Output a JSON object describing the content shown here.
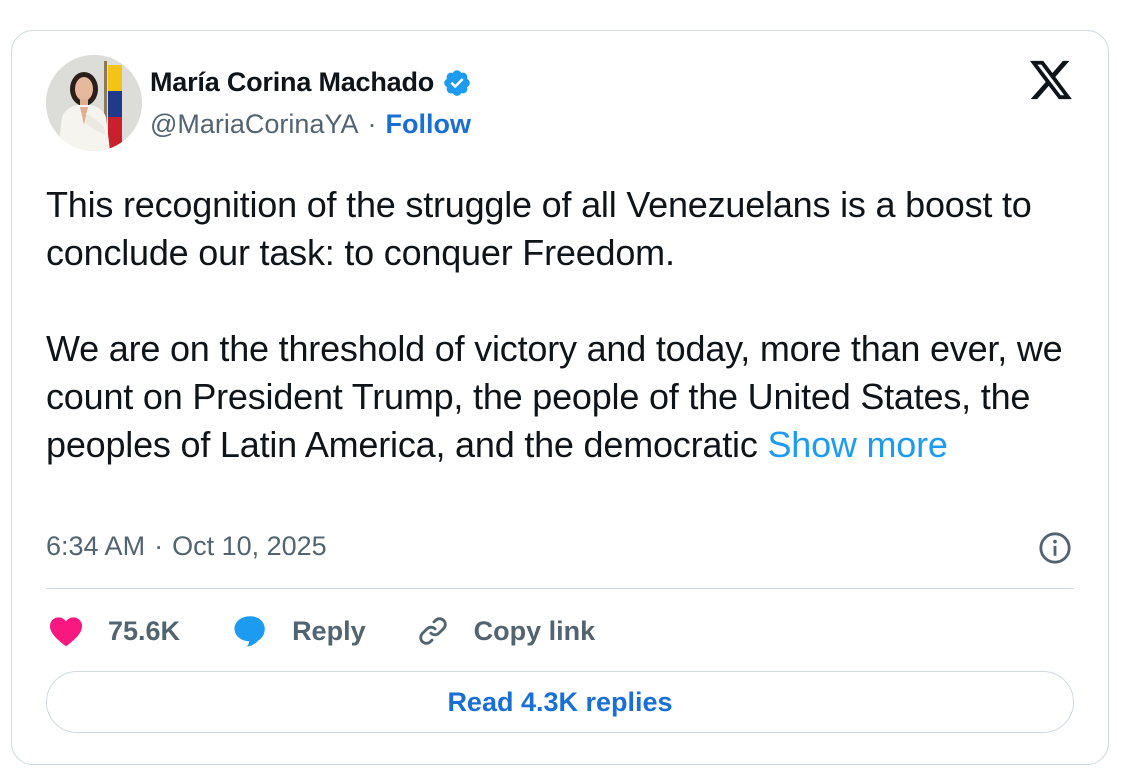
{
  "author": {
    "name": "María Corina Machado",
    "handle": "@MariaCorinaYA",
    "separator": "·",
    "follow_label": "Follow",
    "verified_icon": "verified-badge-icon",
    "avatar_icon": "profile-photo"
  },
  "brand_icon": "x-logo-icon",
  "tweet": {
    "paragraph1": "This recognition of the struggle of all Venezuelans is a boost to conclude our task: to conquer Freedom.",
    "paragraph2": "We are on the threshold of victory and today, more than ever, we count on President Trump, the people of the United States, the peoples of Latin America, and the democratic",
    "show_more_label": "Show more"
  },
  "meta": {
    "time": "6:34 AM",
    "separator": "·",
    "date": "Oct 10, 2025",
    "info_icon": "info-icon"
  },
  "actions": {
    "like_count": "75.6K",
    "reply_label": "Reply",
    "copy_link_label": "Copy link",
    "like_icon": "heart-icon",
    "reply_icon": "speech-bubble-icon",
    "copy_icon": "link-icon"
  },
  "read_replies_label": "Read 4.3K replies",
  "colors": {
    "text": "#0f1419",
    "secondary": "#536471",
    "link": "#1d9bf0",
    "follow": "#1a6fd4",
    "heart": "#f91880",
    "reply": "#1d9bf0",
    "border": "#cfd9de"
  }
}
